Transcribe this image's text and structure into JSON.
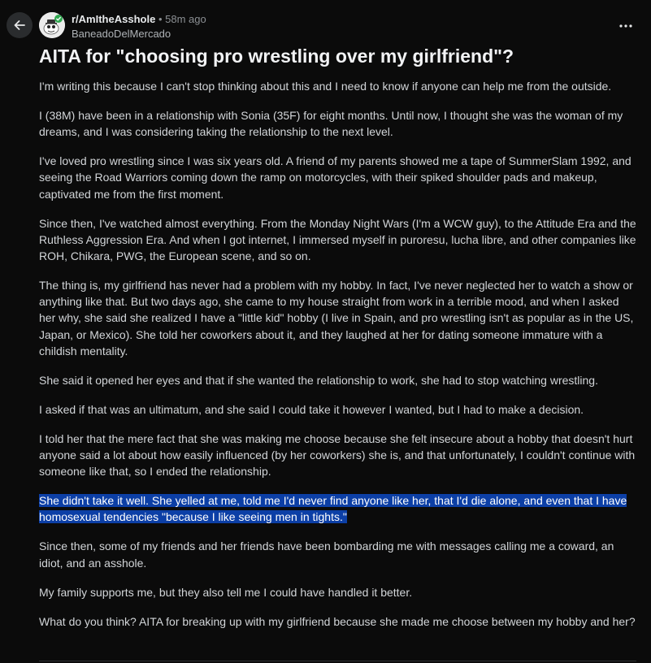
{
  "header": {
    "subreddit": "r/AmItheAsshole",
    "separator": "•",
    "time_ago": "58m ago",
    "username": "BaneadoDelMercado",
    "back_icon": "arrow-left-icon",
    "more_icon": "more-horizontal-icon",
    "avatar_icon": "subreddit-avatar-icon"
  },
  "post": {
    "title": "AITA for \"choosing pro wrestling over my girlfriend\"?",
    "paragraphs": [
      "I'm writing this because I can't stop thinking about this and I need to know if anyone can help me from the outside.",
      "I (38M) have been in a relationship with Sonia (35F) for eight months. Until now, I thought she was the woman of my dreams, and I was considering taking the relationship to the next level.",
      "I've loved pro wrestling since I was six years old. A friend of my parents showed me a tape of SummerSlam 1992, and seeing the Road Warriors coming down the ramp on motorcycles, with their spiked shoulder pads and makeup, captivated me from the first moment.",
      "Since then, I've watched almost everything. From the Monday Night Wars (I'm a WCW guy), to the Attitude Era and the Ruthless Aggression Era. And when I got internet, I immersed myself in puroresu, lucha libre, and other companies like ROH, Chikara, PWG, the European scene, and so on.",
      "The thing is, my girlfriend has never had a problem with my hobby. In fact, I've never neglected her to watch a show or anything like that. But two days ago, she came to my house straight from work in a terrible mood, and when I asked her why, she said she realized I have a \"little kid\" hobby (I live in Spain, and pro wrestling isn't as popular as in the US, Japan, or Mexico). She told her coworkers about it, and they laughed at her for dating someone immature with a childish mentality.",
      "She said it opened her eyes and that if she wanted the relationship to work, she had to stop watching wrestling.",
      "I asked if that was an ultimatum, and she said I could take it however I wanted, but I had to make a decision.",
      "I told her that the mere fact that she was making me choose because she felt insecure about a hobby that doesn't hurt anyone said a lot about how easily influenced (by her coworkers) she is, and that unfortunately, I couldn't continue with someone like that, so I ended the relationship.",
      "She didn't take it well. She yelled at me, told me I'd never find anyone like her, that I'd die alone, and even that I have homosexual tendencies \"because I like seeing men in tights.\"",
      "Since then, some of my friends and her friends have been bombarding me with messages calling me a coward, an idiot, and an asshole.",
      "My family supports me, but they also tell me I could have handled it better.",
      "What do you think? AITA for breaking up with my girlfriend because she made me choose between my hobby and her?"
    ],
    "highlighted_paragraph_index": 8
  },
  "colors": {
    "background": "#0b0b0b",
    "text": "#d2d5d8",
    "title": "#f2f3f5",
    "muted": "#8b8f93",
    "selection_highlight": "#0c3fa6",
    "avatar_badge": "#2fa84f"
  }
}
